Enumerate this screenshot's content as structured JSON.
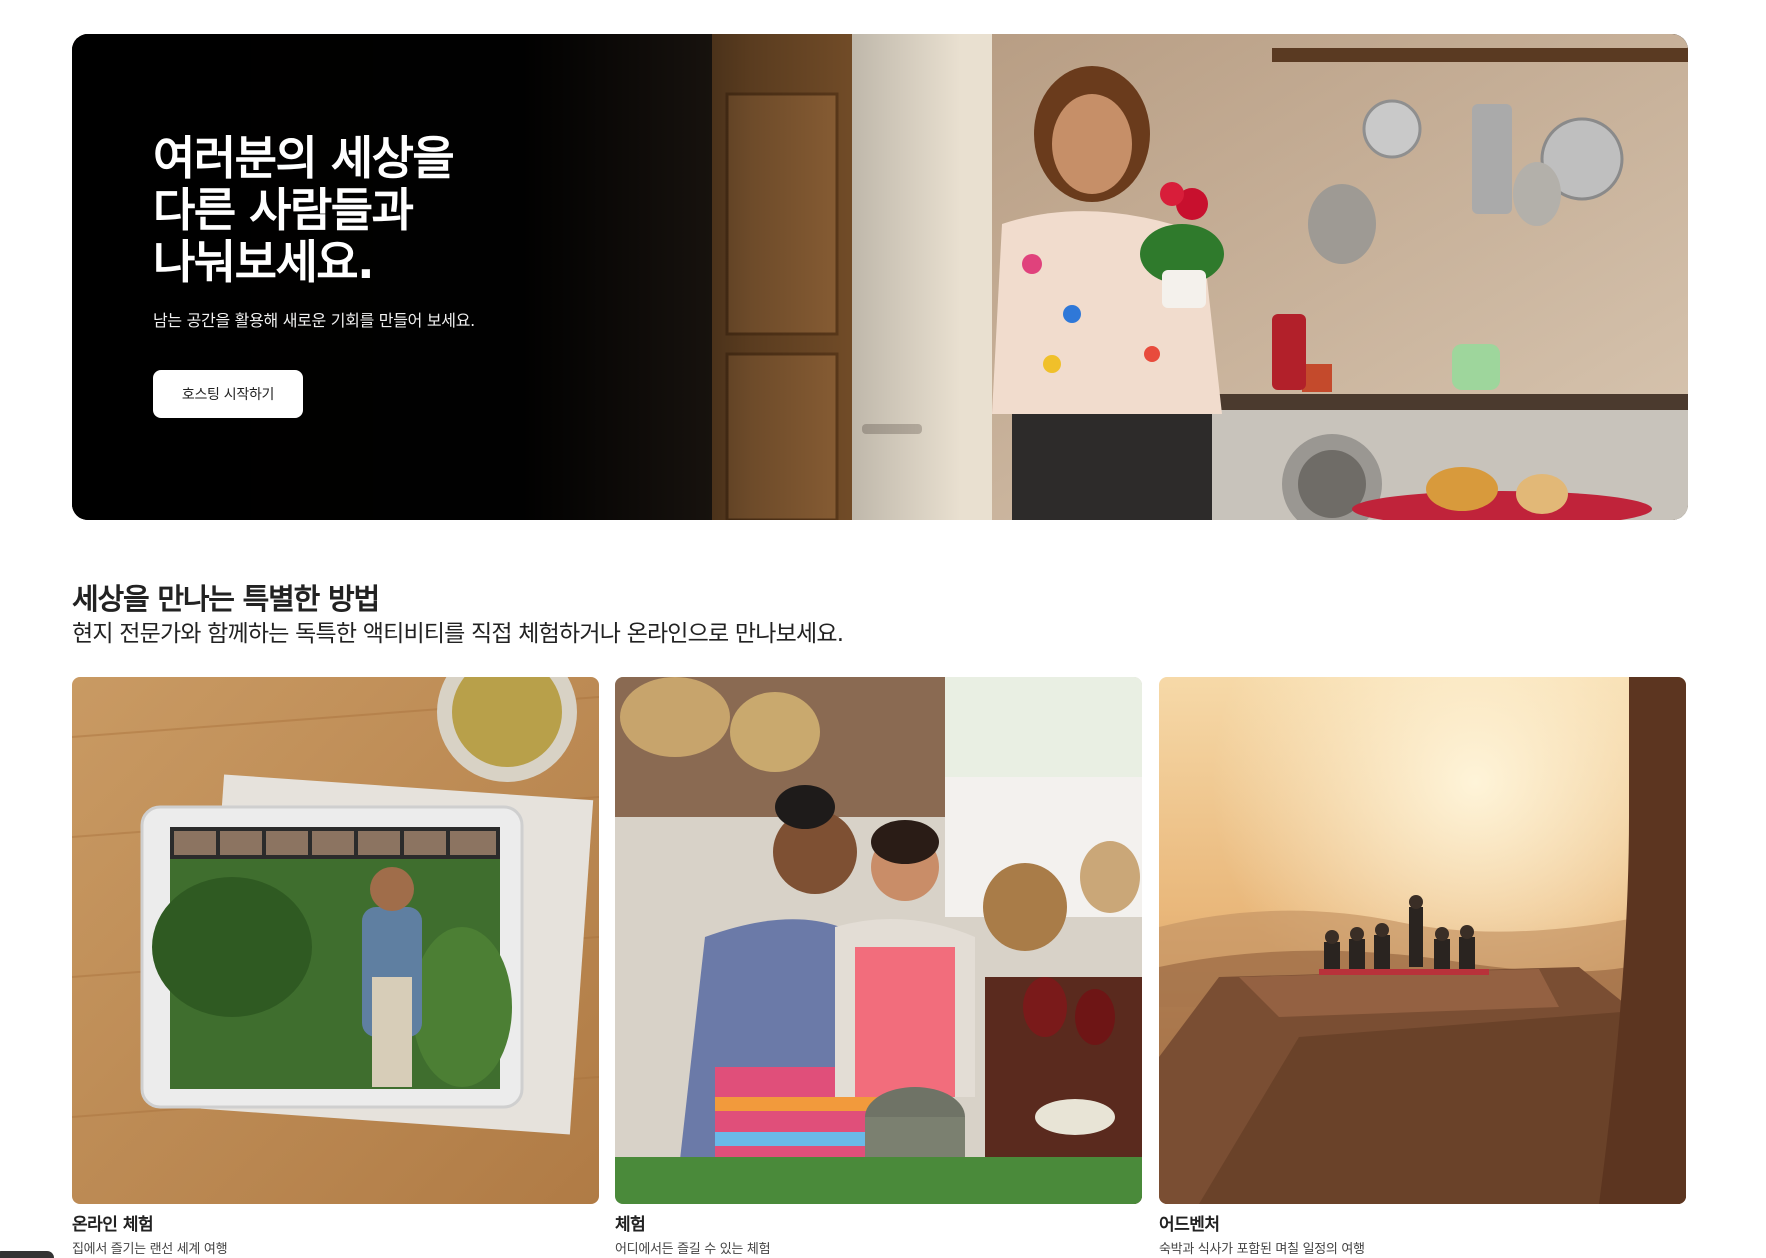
{
  "hero": {
    "title": "여러분의 세상을\n다른 사람들과\n나눠보세요.",
    "subtitle": "남는 공간을 활용해 새로운 기회를 만들어 보세요.",
    "cta_label": "호스팅 시작하기",
    "image": "woman-holding-plant-in-kitchen"
  },
  "section": {
    "title": "세상을 만나는 특별한 방법",
    "subtitle": "현지 전문가와 함께하는 독특한 액티비티를 직접 체험하거나 온라인으로 만나보세요."
  },
  "cards": [
    {
      "title": "온라인 체험",
      "description": "집에서 즐기는 랜선 세계 여행",
      "image": "tablet-video-call-on-wooden-table"
    },
    {
      "title": "체험",
      "description": "어디에서든 즐길 수 있는 체험",
      "image": "two-women-cooking-with-mortar"
    },
    {
      "title": "어드벤처",
      "description": "숙박과 식사가 포함된 며칠 일정의 여행",
      "image": "group-on-cliff-at-sunset"
    }
  ],
  "colors": {
    "text": "#222222",
    "hero_bg": "#000000",
    "button_bg": "#ffffff"
  }
}
